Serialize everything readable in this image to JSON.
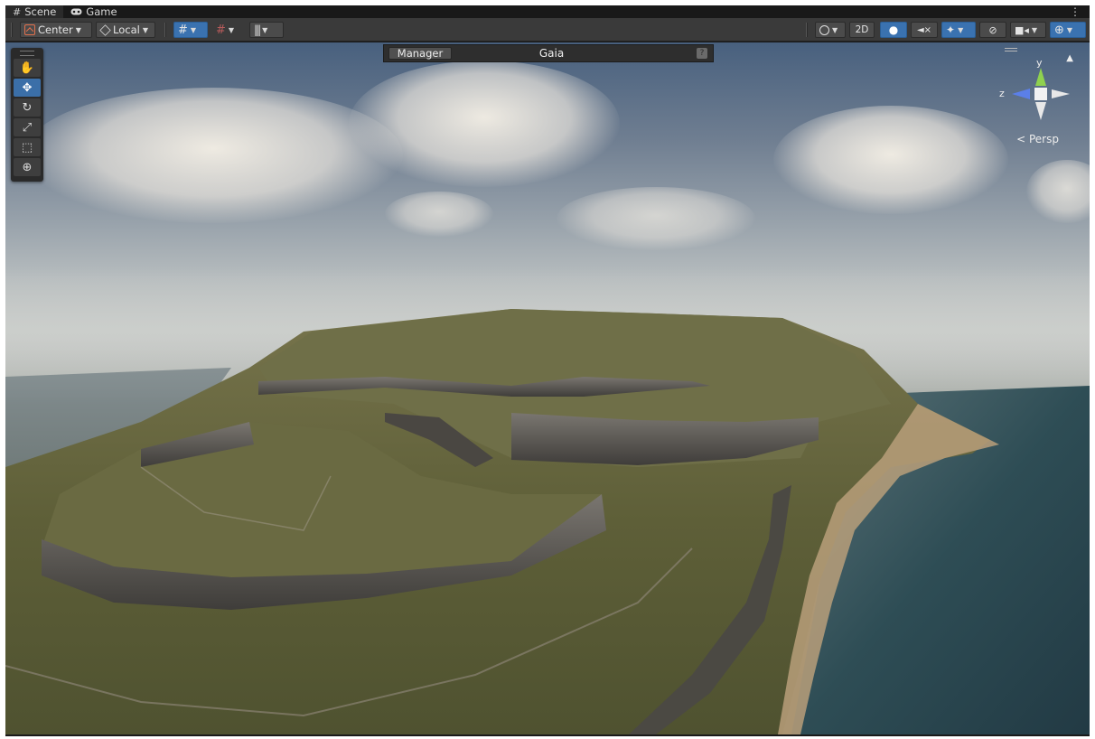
{
  "tabs": [
    {
      "label": "Scene",
      "icon": "scene-hash-icon",
      "active": true
    },
    {
      "label": "Game",
      "icon": "game-controller-icon",
      "active": false
    }
  ],
  "toolbar": {
    "pivot_mode": "Center",
    "pivot_rotation": "Local",
    "toggle_2d": "2D"
  },
  "overlay": {
    "button_label": "Manager",
    "title": "Gaia",
    "help_glyph": "?"
  },
  "gizmo": {
    "y_label": "y",
    "z_label": "z",
    "projection": "< Persp"
  },
  "colors": {
    "accent_blue": "#3a72b0",
    "tool_active": "#3b6fa8",
    "orange_icon": "#e2704d",
    "axis_y": "#8fd14f",
    "axis_z": "#5b7fe8"
  }
}
